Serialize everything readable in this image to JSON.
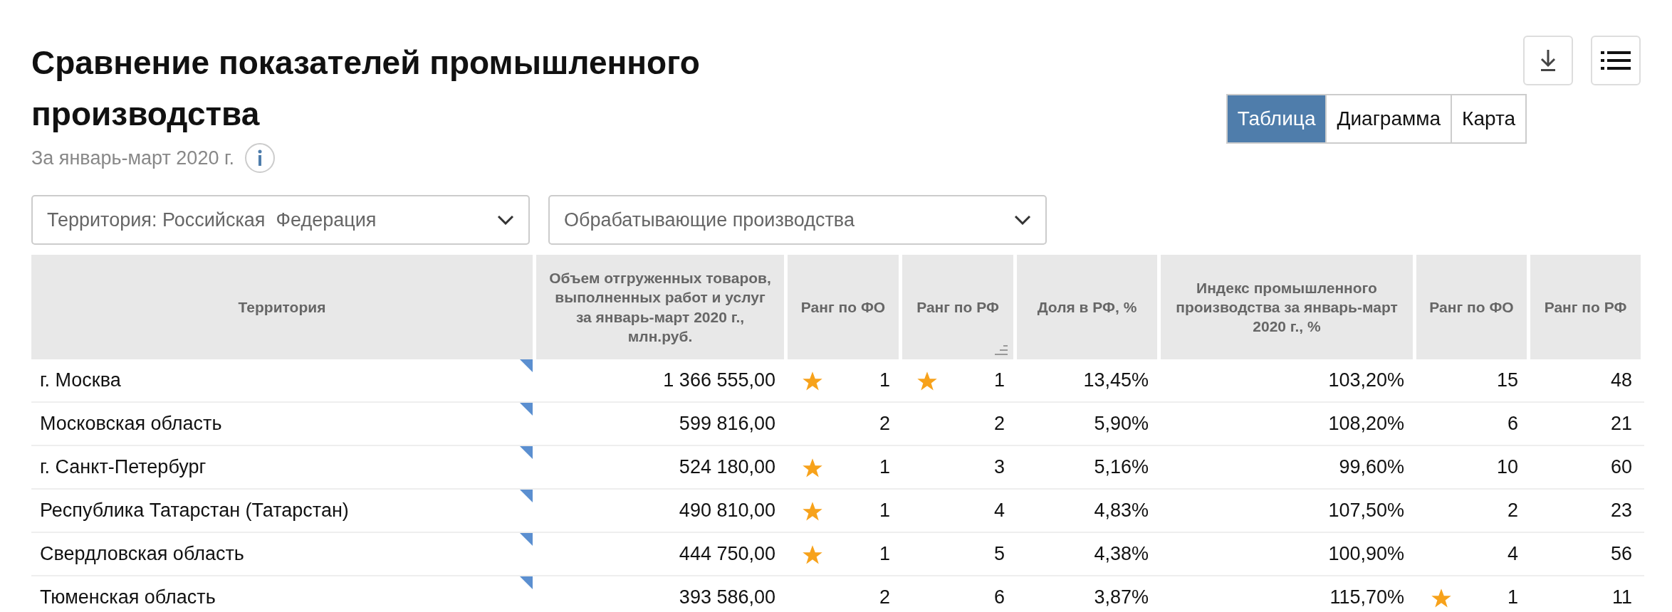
{
  "title": "Сравнение показателей промышленного производства",
  "subtitle": "За январь-март 2020 г.",
  "view_tabs": [
    {
      "label": "Таблица",
      "selected": true
    },
    {
      "label": "Диаграмма",
      "selected": false
    },
    {
      "label": "Карта",
      "selected": false
    }
  ],
  "filters": [
    {
      "value": "Территория: Российская  Федерация"
    },
    {
      "value": "Обрабатывающие производства"
    }
  ],
  "table": {
    "columns": [
      {
        "label": "Территория",
        "sorted": false
      },
      {
        "label": "Объем отгруженных товаров, выполненных работ и услуг за январь-март 2020 г., млн.руб.",
        "sorted": false
      },
      {
        "label": "Ранг по ФО",
        "sorted": false
      },
      {
        "label": "Ранг по РФ",
        "sorted": true
      },
      {
        "label": "Доля в РФ, %",
        "sorted": false
      },
      {
        "label": "Индекс промышленного производства за январь-март 2020 г., %",
        "sorted": false
      },
      {
        "label": "Ранг по ФО",
        "sorted": false
      },
      {
        "label": "Ранг по РФ",
        "sorted": false
      }
    ],
    "rows": [
      {
        "cells": [
          {
            "text": "г. Москва",
            "star": false
          },
          {
            "text": "1 366 555,00",
            "star": false
          },
          {
            "text": "1",
            "star": true
          },
          {
            "text": "1",
            "star": true
          },
          {
            "text": "13,45%",
            "star": false
          },
          {
            "text": "103,20%",
            "star": false
          },
          {
            "text": "15",
            "star": false
          },
          {
            "text": "48",
            "star": false
          }
        ]
      },
      {
        "cells": [
          {
            "text": "Московская область",
            "star": false
          },
          {
            "text": "599 816,00",
            "star": false
          },
          {
            "text": "2",
            "star": false
          },
          {
            "text": "2",
            "star": false
          },
          {
            "text": "5,90%",
            "star": false
          },
          {
            "text": "108,20%",
            "star": false
          },
          {
            "text": "6",
            "star": false
          },
          {
            "text": "21",
            "star": false
          }
        ]
      },
      {
        "cells": [
          {
            "text": "г. Санкт-Петербург",
            "star": false
          },
          {
            "text": "524 180,00",
            "star": false
          },
          {
            "text": "1",
            "star": true
          },
          {
            "text": "3",
            "star": false
          },
          {
            "text": "5,16%",
            "star": false
          },
          {
            "text": "99,60%",
            "star": false
          },
          {
            "text": "10",
            "star": false
          },
          {
            "text": "60",
            "star": false
          }
        ]
      },
      {
        "cells": [
          {
            "text": "Республика Татарстан (Татарстан)",
            "star": false
          },
          {
            "text": "490 810,00",
            "star": false
          },
          {
            "text": "1",
            "star": true
          },
          {
            "text": "4",
            "star": false
          },
          {
            "text": "4,83%",
            "star": false
          },
          {
            "text": "107,50%",
            "star": false
          },
          {
            "text": "2",
            "star": false
          },
          {
            "text": "23",
            "star": false
          }
        ]
      },
      {
        "cells": [
          {
            "text": "Свердловская область",
            "star": false
          },
          {
            "text": "444 750,00",
            "star": false
          },
          {
            "text": "1",
            "star": true
          },
          {
            "text": "5",
            "star": false
          },
          {
            "text": "4,38%",
            "star": false
          },
          {
            "text": "100,90%",
            "star": false
          },
          {
            "text": "4",
            "star": false
          },
          {
            "text": "56",
            "star": false
          }
        ]
      },
      {
        "cells": [
          {
            "text": "Тюменская область",
            "star": false
          },
          {
            "text": "393 586,00",
            "star": false
          },
          {
            "text": "2",
            "star": false
          },
          {
            "text": "6",
            "star": false
          },
          {
            "text": "3,87%",
            "star": false
          },
          {
            "text": "115,70%",
            "star": false
          },
          {
            "text": "1",
            "star": true
          },
          {
            "text": "11",
            "star": false
          }
        ]
      }
    ]
  }
}
